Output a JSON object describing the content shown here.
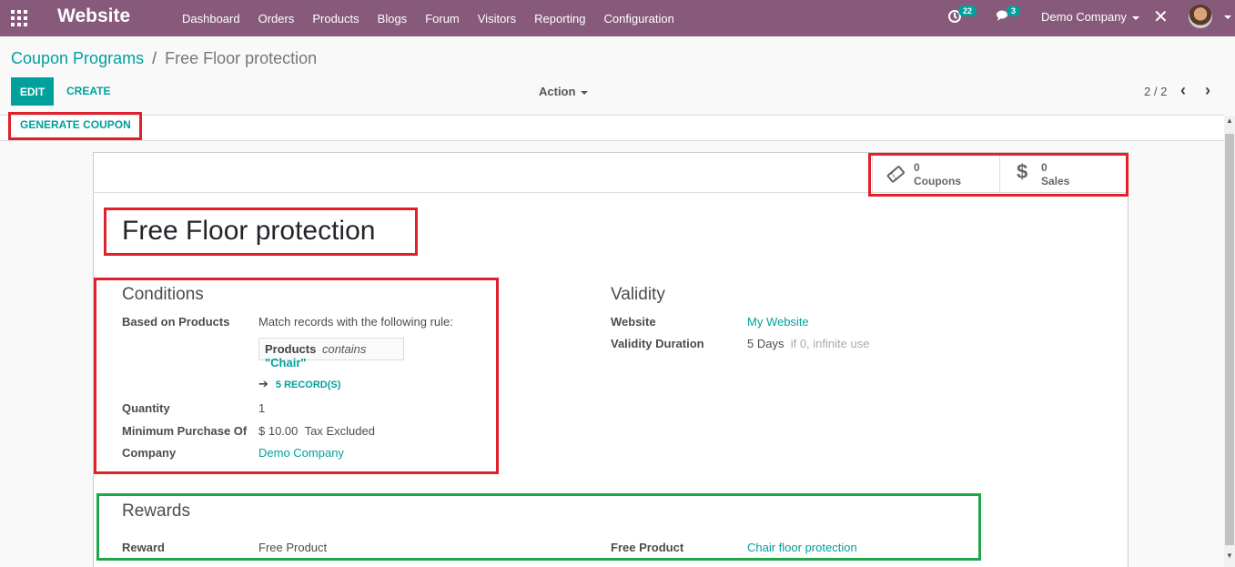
{
  "navbar": {
    "brand": "Website",
    "menu": [
      "Dashboard",
      "Orders",
      "Products",
      "Blogs",
      "Forum",
      "Visitors",
      "Reporting",
      "Configuration"
    ],
    "activity_count": "22",
    "message_count": "3",
    "company": "Demo Company"
  },
  "control": {
    "breadcrumb_parent": "Coupon Programs",
    "breadcrumb_sep": "/",
    "breadcrumb_current": "Free Floor protection",
    "edit_label": "EDIT",
    "create_label": "CREATE",
    "action_label": "Action",
    "pager": "2 / 2"
  },
  "statusbar": {
    "generate_label": "GENERATE COUPON"
  },
  "stats": {
    "coupons_value": "0",
    "coupons_label": "Coupons",
    "sales_value": "0",
    "sales_label": "Sales"
  },
  "form": {
    "title": "Free Floor protection",
    "conditions": {
      "heading": "Conditions",
      "based_on_label": "Based on Products",
      "based_on_value": "Match records with the following rule:",
      "domain_field": "Products",
      "domain_op": "contains",
      "domain_value": "\"Chair\"",
      "records_label": "5 RECORD(S)",
      "quantity_label": "Quantity",
      "quantity_value": "1",
      "min_purchase_label": "Minimum Purchase Of",
      "min_purchase_value": "$ 10.00",
      "min_purchase_tax": "Tax Excluded",
      "company_label": "Company",
      "company_value": "Demo Company"
    },
    "validity": {
      "heading": "Validity",
      "website_label": "Website",
      "website_value": "My Website",
      "duration_label": "Validity Duration",
      "duration_value": "5 Days",
      "duration_hint": "if 0, infinite use"
    },
    "rewards": {
      "heading": "Rewards",
      "reward_label": "Reward",
      "reward_value": "Free Product",
      "free_product_label": "Free Product",
      "free_product_value": "Chair floor protection"
    }
  },
  "colors": {
    "navbar": "#875a7b",
    "accent": "#00a09d",
    "highlight_red": "#e0202a",
    "highlight_green": "#1ea84a"
  }
}
